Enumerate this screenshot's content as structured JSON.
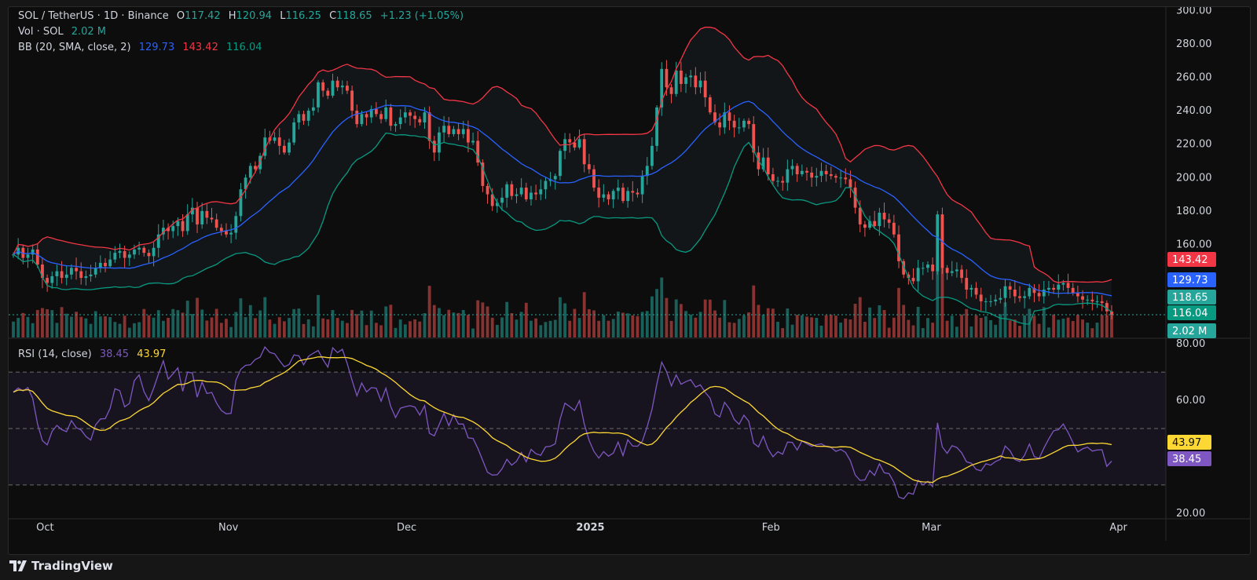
{
  "header": {
    "symbol": "SOL / TetherUS · 1D · Binance",
    "o_label": "O",
    "o_value": "117.42",
    "h_label": "H",
    "h_value": "120.94",
    "l_label": "L",
    "l_value": "116.25",
    "c_label": "C",
    "c_value": "118.65",
    "change": "+1.23 (+1.05%)",
    "vol_label": "Vol · SOL",
    "vol_value": "2.02 M",
    "bb_label": "BB (20, SMA, close, 2)",
    "bb_basis": "129.73",
    "bb_upper": "143.42",
    "bb_lower": "116.04",
    "rsi_label": "RSI (14, close)",
    "rsi_value": "38.45",
    "rsi_ma": "43.97"
  },
  "footer": {
    "brand": "TradingView"
  },
  "colors": {
    "up": "#26a69a",
    "down": "#ef5350",
    "bb_basis": "#2962ff",
    "bb_upper": "#f23645",
    "bb_lower": "#089981",
    "rsi": "#7e57c2",
    "rsi_ma": "#fdd835"
  },
  "price_labels": [
    {
      "text": "143.42",
      "color": "#f23645"
    },
    {
      "text": "129.73",
      "color": "#2962ff"
    },
    {
      "text": "118.65",
      "color": "#26a69a"
    },
    {
      "text": "116.04",
      "color": "#089981"
    },
    {
      "text": "2.02 M",
      "color": "#26a69a"
    }
  ],
  "rsi_labels": [
    {
      "text": "43.97",
      "color": "#fdd835"
    },
    {
      "text": "38.45",
      "color": "#7e57c2"
    }
  ],
  "chart_data": {
    "type": "candlestick",
    "x_labels": [
      "Oct",
      "Nov",
      "Dec",
      "2025",
      "Feb",
      "Mar",
      "Apr"
    ],
    "price_axis": {
      "ticks": [
        "300.00",
        "280.00",
        "260.00",
        "240.00",
        "220.00",
        "200.00",
        "180.00",
        "160.00"
      ],
      "range": [
        110,
        302
      ]
    },
    "rsi_axis": {
      "ticks": [
        "80.00",
        "60.00",
        "20.00"
      ],
      "range": [
        18,
        82
      ],
      "bands": [
        70,
        50,
        30
      ]
    },
    "close": [
      154,
      158,
      152,
      154,
      157,
      148,
      140,
      137,
      141,
      144,
      140,
      142,
      146,
      144,
      140,
      141,
      142,
      146,
      149,
      147,
      151,
      155,
      156,
      152,
      154,
      157,
      158,
      155,
      153,
      158,
      166,
      170,
      168,
      171,
      174,
      168,
      178,
      182,
      172,
      180,
      176,
      175,
      170,
      168,
      166,
      167,
      177,
      193,
      200,
      207,
      205,
      213,
      224,
      222,
      224,
      219,
      215,
      221,
      233,
      238,
      234,
      240,
      242,
      257,
      252,
      249,
      258,
      254,
      255,
      252,
      240,
      232,
      238,
      236,
      241,
      238,
      235,
      242,
      231,
      232,
      236,
      239,
      237,
      235,
      233,
      239,
      222,
      215,
      227,
      231,
      226,
      229,
      226,
      229,
      221,
      222,
      209,
      195,
      190,
      183,
      185,
      188,
      196,
      189,
      190,
      194,
      187,
      191,
      190,
      193,
      198,
      199,
      201,
      216,
      223,
      221,
      218,
      223,
      208,
      205,
      194,
      188,
      190,
      187,
      192,
      194,
      186,
      192,
      191,
      190,
      201,
      207,
      219,
      242,
      265,
      254,
      250,
      264,
      256,
      260,
      261,
      254,
      258,
      248,
      239,
      233,
      230,
      239,
      234,
      230,
      230,
      234,
      232,
      215,
      205,
      212,
      202,
      198,
      198,
      197,
      205,
      207,
      202,
      204,
      203,
      200,
      201,
      204,
      202,
      201,
      200,
      200,
      199,
      194,
      182,
      172,
      170,
      174,
      171,
      179,
      175,
      173,
      166,
      150,
      142,
      140,
      138,
      146,
      146,
      148,
      144,
      178,
      146,
      143,
      144,
      145,
      140,
      133,
      134,
      130,
      126,
      126,
      126,
      127,
      128,
      135,
      133,
      129,
      128,
      129,
      134,
      131,
      129,
      133,
      134,
      133,
      136,
      137,
      134,
      131,
      129,
      127,
      127,
      126,
      126,
      125,
      120,
      118
    ],
    "rsi": [
      62.9,
      64.4,
      63.3,
      64.5,
      60.7,
      51.6,
      45.7,
      44.2,
      49.0,
      51.1,
      49.6,
      48.9,
      52.8,
      50.3,
      49.5,
      47.2,
      45.9,
      51.3,
      53.4,
      53.5,
      57.2,
      64.1,
      63.4,
      57.7,
      58.9,
      67.0,
      69.0,
      63.1,
      59.9,
      64.3,
      69.4,
      74.0,
      67.5,
      69.4,
      71.5,
      63.2,
      70.0,
      69.7,
      61.1,
      66.5,
      62.4,
      62.8,
      59.0,
      56.4,
      55.2,
      55.4,
      67.1,
      71.0,
      72.4,
      72.6,
      74.5,
      75.3,
      78.9,
      77.0,
      76.5,
      74.1,
      71.9,
      72.7,
      76.1,
      75.8,
      72.6,
      75.6,
      76.7,
      77.7,
      74.5,
      71.8,
      78.6,
      76.9,
      78.1,
      73.1,
      67.1,
      61.6,
      66.1,
      63.0,
      64.5,
      64.3,
      59.7,
      64.3,
      57.8,
      53.9,
      57.2,
      57.7,
      58.1,
      57.6,
      54.8,
      58.1,
      48.3,
      47.4,
      51.4,
      55.4,
      51.0,
      54.9,
      51.6,
      51.6,
      46.7,
      46.5,
      43.0,
      38.7,
      34.5,
      33.5,
      33.6,
      35.7,
      39.1,
      37.0,
      38.4,
      41.5,
      38.2,
      42.6,
      41.1,
      40.5,
      43.5,
      43.7,
      44.6,
      53.3,
      59.0,
      57.8,
      56.4,
      59.9,
      51.6,
      45.8,
      41.9,
      39.5,
      41.8,
      40.2,
      41.3,
      45.2,
      40.4,
      46.0,
      43.8,
      43.7,
      45.5,
      50.7,
      56.8,
      65.8,
      73.5,
      70.2,
      65.1,
      69.0,
      65.7,
      66.6,
      67.3,
      64.7,
      65.5,
      62.8,
      60.8,
      55.2,
      54.1,
      59.3,
      57.0,
      53.2,
      51.5,
      54.7,
      52.6,
      44.8,
      43.5,
      47.3,
      42.7,
      40.0,
      41.8,
      40.9,
      45.2,
      45.1,
      42.4,
      45.6,
      44.6,
      43.7,
      44.2,
      44.6,
      43.6,
      43.3,
      41.9,
      42.6,
      41.5,
      38.6,
      33.5,
      31.6,
      31.8,
      35.1,
      33.4,
      37.5,
      34.3,
      34.0,
      30.9,
      25.7,
      25.1,
      27.2,
      26.7,
      31.7,
      30.0,
      31.3,
      29.4,
      52.0,
      43.5,
      41.2,
      43.9,
      43.3,
      41.4,
      38.2,
      37.7,
      35.5,
      35.0,
      37.5,
      37.0,
      38.3,
      39.1,
      43.8,
      42.1,
      39.0,
      38.3,
      40.5,
      44.5,
      40.0,
      39.4,
      43.1,
      46.3,
      49.2,
      49.6,
      51.6,
      48.6,
      45.0,
      41.7,
      42.8,
      43.4,
      42.0,
      42.4,
      42.5,
      36.6,
      38.45
    ]
  }
}
